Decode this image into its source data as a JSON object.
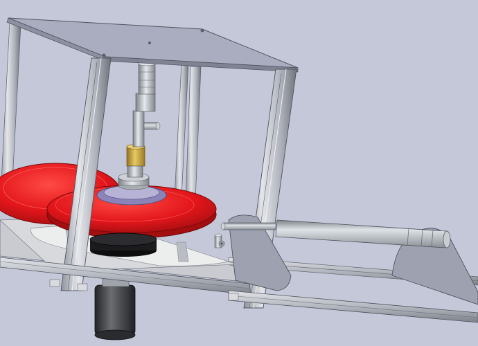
{
  "viewport": {
    "background": "#c4c8d9"
  },
  "model": {
    "colors": {
      "frame": "#b8bcc6",
      "frame_light": "#dfe2e8",
      "frame_dark": "#7a7f8a",
      "top_plate": "#a9adbf",
      "top_plate_edge": "#5f6370",
      "disc_red": "#e3161b",
      "disc_red_dark": "#a30e10",
      "disc_red_light": "#ff5a55",
      "base_plate": "#cfd1d6",
      "base_inner": "#e4e5e8",
      "black": "#1b1b1d",
      "brass": "#c9a43c",
      "brass_dark": "#8f7122",
      "shaft": "#b9bec4",
      "motor": "#3a3c40"
    },
    "icons": [
      "gear-icon"
    ]
  }
}
